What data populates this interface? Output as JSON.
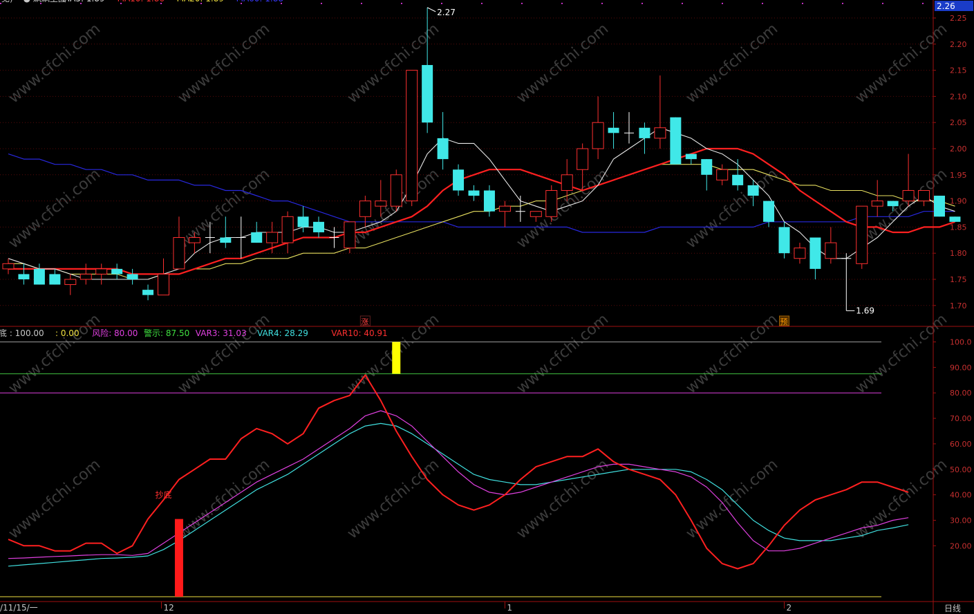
{
  "header": {
    "top_items": [
      {
        "text": "/见)",
        "color": "#c8c8c8"
      },
      {
        "text": "● 飙飙主图",
        "color": "#c8c8c8"
      },
      {
        "text": "MA5: 1.89",
        "color": "#e6e6e6"
      },
      {
        "text": "MA10: 1.86",
        "color": "#ff3030"
      },
      {
        "text": "MA20: 1.89",
        "color": "#f0e040"
      },
      {
        "text": "MA60: 1.88",
        "color": "#3a3aff"
      }
    ],
    "current_price_tag": "2.26"
  },
  "price_chart": {
    "type": "candlestick",
    "ylim": [
      1.66,
      2.27
    ],
    "y_ticks": [
      "2.25",
      "2.20",
      "2.15",
      "2.10",
      "2.05",
      "2.00",
      "1.95",
      "1.90",
      "1.85",
      "1.80",
      "1.75",
      "1.70"
    ],
    "high_label": "2.27",
    "low_label": "1.69",
    "markers": [
      {
        "text": "涨",
        "color": "#ff4040"
      },
      {
        "text": "预",
        "color": "#ff9900"
      }
    ],
    "candles": [
      {
        "o": 1.77,
        "h": 1.79,
        "l": 1.76,
        "c": 1.78
      },
      {
        "o": 1.76,
        "h": 1.78,
        "l": 1.74,
        "c": 1.75
      },
      {
        "o": 1.77,
        "h": 1.78,
        "l": 1.74,
        "c": 1.74
      },
      {
        "o": 1.76,
        "h": 1.77,
        "l": 1.74,
        "c": 1.74
      },
      {
        "o": 1.74,
        "h": 1.76,
        "l": 1.72,
        "c": 1.75
      },
      {
        "o": 1.75,
        "h": 1.78,
        "l": 1.74,
        "c": 1.76
      },
      {
        "o": 1.76,
        "h": 1.78,
        "l": 1.74,
        "c": 1.77
      },
      {
        "o": 1.77,
        "h": 1.78,
        "l": 1.75,
        "c": 1.76
      },
      {
        "o": 1.76,
        "h": 1.77,
        "l": 1.74,
        "c": 1.75
      },
      {
        "o": 1.73,
        "h": 1.74,
        "l": 1.71,
        "c": 1.72
      },
      {
        "o": 1.72,
        "h": 1.79,
        "l": 1.72,
        "c": 1.76
      },
      {
        "o": 1.77,
        "h": 1.87,
        "l": 1.77,
        "c": 1.83
      },
      {
        "o": 1.82,
        "h": 1.84,
        "l": 1.8,
        "c": 1.83
      },
      {
        "o": 1.83,
        "h": 1.86,
        "l": 1.8,
        "c": 1.83
      },
      {
        "o": 1.83,
        "h": 1.87,
        "l": 1.81,
        "c": 1.82
      },
      {
        "o": 1.83,
        "h": 1.87,
        "l": 1.79,
        "c": 1.83
      },
      {
        "o": 1.84,
        "h": 1.86,
        "l": 1.82,
        "c": 1.82
      },
      {
        "o": 1.82,
        "h": 1.86,
        "l": 1.8,
        "c": 1.84
      },
      {
        "o": 1.82,
        "h": 1.88,
        "l": 1.8,
        "c": 1.87
      },
      {
        "o": 1.87,
        "h": 1.89,
        "l": 1.84,
        "c": 1.85
      },
      {
        "o": 1.86,
        "h": 1.87,
        "l": 1.83,
        "c": 1.84
      },
      {
        "o": 1.83,
        "h": 1.85,
        "l": 1.81,
        "c": 1.83
      },
      {
        "o": 1.81,
        "h": 1.86,
        "l": 1.8,
        "c": 1.86
      },
      {
        "o": 1.87,
        "h": 1.91,
        "l": 1.85,
        "c": 1.9
      },
      {
        "o": 1.89,
        "h": 1.94,
        "l": 1.87,
        "c": 1.9
      },
      {
        "o": 1.89,
        "h": 1.96,
        "l": 1.88,
        "c": 1.95
      },
      {
        "o": 1.9,
        "h": 2.15,
        "l": 1.89,
        "c": 2.15
      },
      {
        "o": 2.16,
        "h": 2.27,
        "l": 2.03,
        "c": 2.05
      },
      {
        "o": 2.02,
        "h": 2.07,
        "l": 1.96,
        "c": 1.98
      },
      {
        "o": 1.96,
        "h": 1.97,
        "l": 1.91,
        "c": 1.92
      },
      {
        "o": 1.92,
        "h": 1.93,
        "l": 1.9,
        "c": 1.91
      },
      {
        "o": 1.92,
        "h": 1.93,
        "l": 1.87,
        "c": 1.88
      },
      {
        "o": 1.88,
        "h": 1.9,
        "l": 1.85,
        "c": 1.89
      },
      {
        "o": 1.88,
        "h": 1.91,
        "l": 1.86,
        "c": 1.88
      },
      {
        "o": 1.87,
        "h": 1.88,
        "l": 1.86,
        "c": 1.88
      },
      {
        "o": 1.87,
        "h": 1.93,
        "l": 1.86,
        "c": 1.92
      },
      {
        "o": 1.92,
        "h": 1.98,
        "l": 1.9,
        "c": 1.95
      },
      {
        "o": 1.96,
        "h": 2.01,
        "l": 1.92,
        "c": 2.0
      },
      {
        "o": 2.0,
        "h": 2.1,
        "l": 1.98,
        "c": 2.05
      },
      {
        "o": 2.04,
        "h": 2.07,
        "l": 2.0,
        "c": 2.03
      },
      {
        "o": 2.03,
        "h": 2.07,
        "l": 2.01,
        "c": 2.03
      },
      {
        "o": 2.04,
        "h": 2.05,
        "l": 1.99,
        "c": 2.02
      },
      {
        "o": 2.02,
        "h": 2.14,
        "l": 2.0,
        "c": 2.04
      },
      {
        "o": 2.06,
        "h": 2.06,
        "l": 1.97,
        "c": 1.97
      },
      {
        "o": 1.99,
        "h": 1.99,
        "l": 1.97,
        "c": 1.98
      },
      {
        "o": 1.98,
        "h": 1.98,
        "l": 1.92,
        "c": 1.95
      },
      {
        "o": 1.94,
        "h": 1.97,
        "l": 1.93,
        "c": 1.96
      },
      {
        "o": 1.95,
        "h": 1.98,
        "l": 1.92,
        "c": 1.93
      },
      {
        "o": 1.93,
        "h": 1.94,
        "l": 1.89,
        "c": 1.91
      },
      {
        "o": 1.9,
        "h": 1.9,
        "l": 1.85,
        "c": 1.86
      },
      {
        "o": 1.85,
        "h": 1.86,
        "l": 1.79,
        "c": 1.8
      },
      {
        "o": 1.79,
        "h": 1.82,
        "l": 1.78,
        "c": 1.81
      },
      {
        "o": 1.83,
        "h": 1.83,
        "l": 1.75,
        "c": 1.77
      },
      {
        "o": 1.79,
        "h": 1.85,
        "l": 1.78,
        "c": 1.82
      },
      {
        "o": 1.79,
        "h": 1.8,
        "l": 1.69,
        "c": 1.79
      },
      {
        "o": 1.78,
        "h": 1.89,
        "l": 1.77,
        "c": 1.89
      },
      {
        "o": 1.89,
        "h": 1.94,
        "l": 1.87,
        "c": 1.9
      },
      {
        "o": 1.9,
        "h": 1.9,
        "l": 1.88,
        "c": 1.89
      },
      {
        "o": 1.9,
        "h": 1.99,
        "l": 1.89,
        "c": 1.92
      },
      {
        "o": 1.9,
        "h": 1.92,
        "l": 1.89,
        "c": 1.92
      },
      {
        "o": 1.91,
        "h": 1.91,
        "l": 1.87,
        "c": 1.87
      },
      {
        "o": 1.87,
        "h": 1.87,
        "l": 1.86,
        "c": 1.86
      }
    ],
    "ma5": [
      1.79,
      1.78,
      1.77,
      1.77,
      1.76,
      1.75,
      1.75,
      1.75,
      1.75,
      1.75,
      1.76,
      1.77,
      1.8,
      1.82,
      1.83,
      1.83,
      1.84,
      1.84,
      1.84,
      1.85,
      1.85,
      1.84,
      1.84,
      1.85,
      1.86,
      1.88,
      1.93,
      1.99,
      2.02,
      2.01,
      2.01,
      1.98,
      1.94,
      1.9,
      1.89,
      1.88,
      1.89,
      1.9,
      1.93,
      1.98,
      2.0,
      2.02,
      2.04,
      2.03,
      2.02,
      2.0,
      1.99,
      1.97,
      1.94,
      1.91,
      1.86,
      1.84,
      1.81,
      1.79,
      1.79,
      1.81,
      1.83,
      1.86,
      1.89,
      1.91,
      1.89,
      1.88
    ],
    "ma10": [
      1.77,
      1.77,
      1.77,
      1.77,
      1.77,
      1.77,
      1.77,
      1.77,
      1.76,
      1.76,
      1.76,
      1.76,
      1.77,
      1.78,
      1.79,
      1.79,
      1.8,
      1.81,
      1.82,
      1.83,
      1.83,
      1.83,
      1.84,
      1.84,
      1.85,
      1.86,
      1.87,
      1.89,
      1.92,
      1.94,
      1.95,
      1.96,
      1.96,
      1.96,
      1.95,
      1.94,
      1.93,
      1.92,
      1.93,
      1.94,
      1.95,
      1.96,
      1.97,
      1.98,
      1.99,
      2.0,
      2.0,
      2.0,
      1.99,
      1.97,
      1.95,
      1.92,
      1.9,
      1.88,
      1.86,
      1.85,
      1.85,
      1.84,
      1.84,
      1.85,
      1.85,
      1.86
    ],
    "ma20": [
      1.78,
      1.78,
      1.77,
      1.77,
      1.76,
      1.76,
      1.76,
      1.76,
      1.75,
      1.75,
      1.76,
      1.76,
      1.77,
      1.77,
      1.78,
      1.78,
      1.79,
      1.79,
      1.79,
      1.8,
      1.8,
      1.8,
      1.81,
      1.81,
      1.82,
      1.83,
      1.84,
      1.85,
      1.86,
      1.87,
      1.88,
      1.88,
      1.89,
      1.89,
      1.9,
      1.9,
      1.91,
      1.92,
      1.93,
      1.94,
      1.95,
      1.96,
      1.97,
      1.97,
      1.97,
      1.97,
      1.96,
      1.96,
      1.96,
      1.95,
      1.94,
      1.93,
      1.93,
      1.92,
      1.92,
      1.92,
      1.91,
      1.91,
      1.9,
      1.9,
      1.9,
      1.89
    ],
    "ma60": [
      1.99,
      1.98,
      1.98,
      1.97,
      1.97,
      1.96,
      1.96,
      1.95,
      1.95,
      1.94,
      1.94,
      1.94,
      1.93,
      1.93,
      1.92,
      1.92,
      1.91,
      1.9,
      1.9,
      1.89,
      1.88,
      1.87,
      1.86,
      1.86,
      1.86,
      1.86,
      1.86,
      1.86,
      1.86,
      1.85,
      1.85,
      1.85,
      1.85,
      1.85,
      1.85,
      1.85,
      1.85,
      1.84,
      1.84,
      1.84,
      1.84,
      1.84,
      1.85,
      1.85,
      1.85,
      1.85,
      1.85,
      1.85,
      1.85,
      1.86,
      1.86,
      1.86,
      1.86,
      1.86,
      1.86,
      1.87,
      1.87,
      1.87,
      1.87,
      1.88,
      1.88,
      1.88
    ]
  },
  "chart_data": {
    "type": "line",
    "title": "",
    "ylim": [
      0,
      103
    ],
    "y_ticks": [
      "100.0",
      "90.00",
      "80.00",
      "70.00",
      "60.00",
      "50.00",
      "40.00",
      "30.00",
      "20.00"
    ],
    "header_items": [
      {
        "text": "底 : 100.00",
        "color": "#c8c8c8"
      },
      {
        "text": ": 0.00",
        "color": "#f0e040"
      },
      {
        "text": "风险: 80.00",
        "color": "#e040e0"
      },
      {
        "text": "警示: 87.50",
        "color": "#40e040"
      },
      {
        "text": "VAR3: 31.03",
        "color": "#e040e0"
      },
      {
        "text": "VAR4: 28.29",
        "color": "#40e0e0"
      },
      {
        "text": "VAR10: 40.91",
        "color": "#ff3030"
      }
    ],
    "reference_lines": [
      {
        "value": 100,
        "color": "#9a9a9a"
      },
      {
        "value": 87.5,
        "color": "#40c040"
      },
      {
        "value": 80,
        "color": "#e040e0"
      },
      {
        "value": 0,
        "color": "#f0e040"
      }
    ],
    "annotation": {
      "text": "抄底",
      "color": "#ff3030"
    },
    "signal_bars": [
      {
        "index": 10,
        "from": 0,
        "to": 30.5,
        "color": "#ff1a1a"
      },
      {
        "index": 24,
        "from": 87.5,
        "to": 100,
        "color": "#ffff00"
      }
    ],
    "series": [
      {
        "name": "VAR10",
        "color": "#ff2020",
        "width": 2,
        "values": [
          22.5,
          20,
          20,
          18,
          18,
          21,
          21,
          17,
          20,
          30.5,
          38,
          46,
          50,
          54,
          54,
          62,
          66,
          64,
          60,
          64,
          74,
          77,
          79,
          87,
          77,
          65,
          55,
          46,
          40,
          36,
          34,
          36,
          40,
          46,
          51,
          53,
          55,
          55,
          58,
          53,
          50,
          48,
          46,
          40,
          30,
          19,
          13,
          11,
          13,
          20,
          28,
          34,
          38,
          40,
          42,
          45,
          45,
          43,
          41
        ]
      },
      {
        "name": "VAR3",
        "color": "#e040e0",
        "width": 1.2,
        "values": [
          15,
          15.2,
          15.5,
          15.8,
          16,
          16.3,
          16.5,
          16.5,
          16.2,
          17,
          21,
          25,
          29,
          33,
          37,
          41,
          45,
          48,
          51,
          54,
          58,
          62,
          66,
          71,
          73,
          71,
          67,
          61,
          55,
          49,
          44,
          41,
          40,
          41,
          43,
          45,
          47,
          49,
          51,
          52,
          52,
          51,
          50,
          49,
          47,
          43,
          37,
          29,
          22,
          18,
          18,
          19,
          21,
          23,
          25,
          27,
          28,
          30,
          31.03
        ]
      },
      {
        "name": "VAR4",
        "color": "#40e0e0",
        "width": 1.2,
        "values": [
          12,
          12.5,
          13,
          13.5,
          14,
          14.5,
          15,
          15.2,
          15.5,
          16,
          18.5,
          22,
          26,
          30,
          34,
          38,
          42,
          45,
          48,
          52,
          56,
          60,
          64,
          67,
          68,
          67,
          64,
          60,
          56,
          52,
          48,
          46,
          45,
          44,
          44,
          45,
          46,
          47,
          48,
          49,
          50,
          50,
          50,
          50,
          49,
          46,
          42,
          36,
          30,
          26,
          23,
          22,
          22,
          22,
          23,
          24,
          26,
          27,
          28.29
        ]
      }
    ]
  },
  "x_axis": {
    "labels": [
      {
        "text": "/11/15/一",
        "pos": "start"
      },
      {
        "text": "12",
        "pos": "dec"
      },
      {
        "text": "1",
        "pos": "jan"
      },
      {
        "text": "2",
        "pos": "feb"
      }
    ],
    "period_label": "日线"
  },
  "watermark": "www.cfchi.com"
}
